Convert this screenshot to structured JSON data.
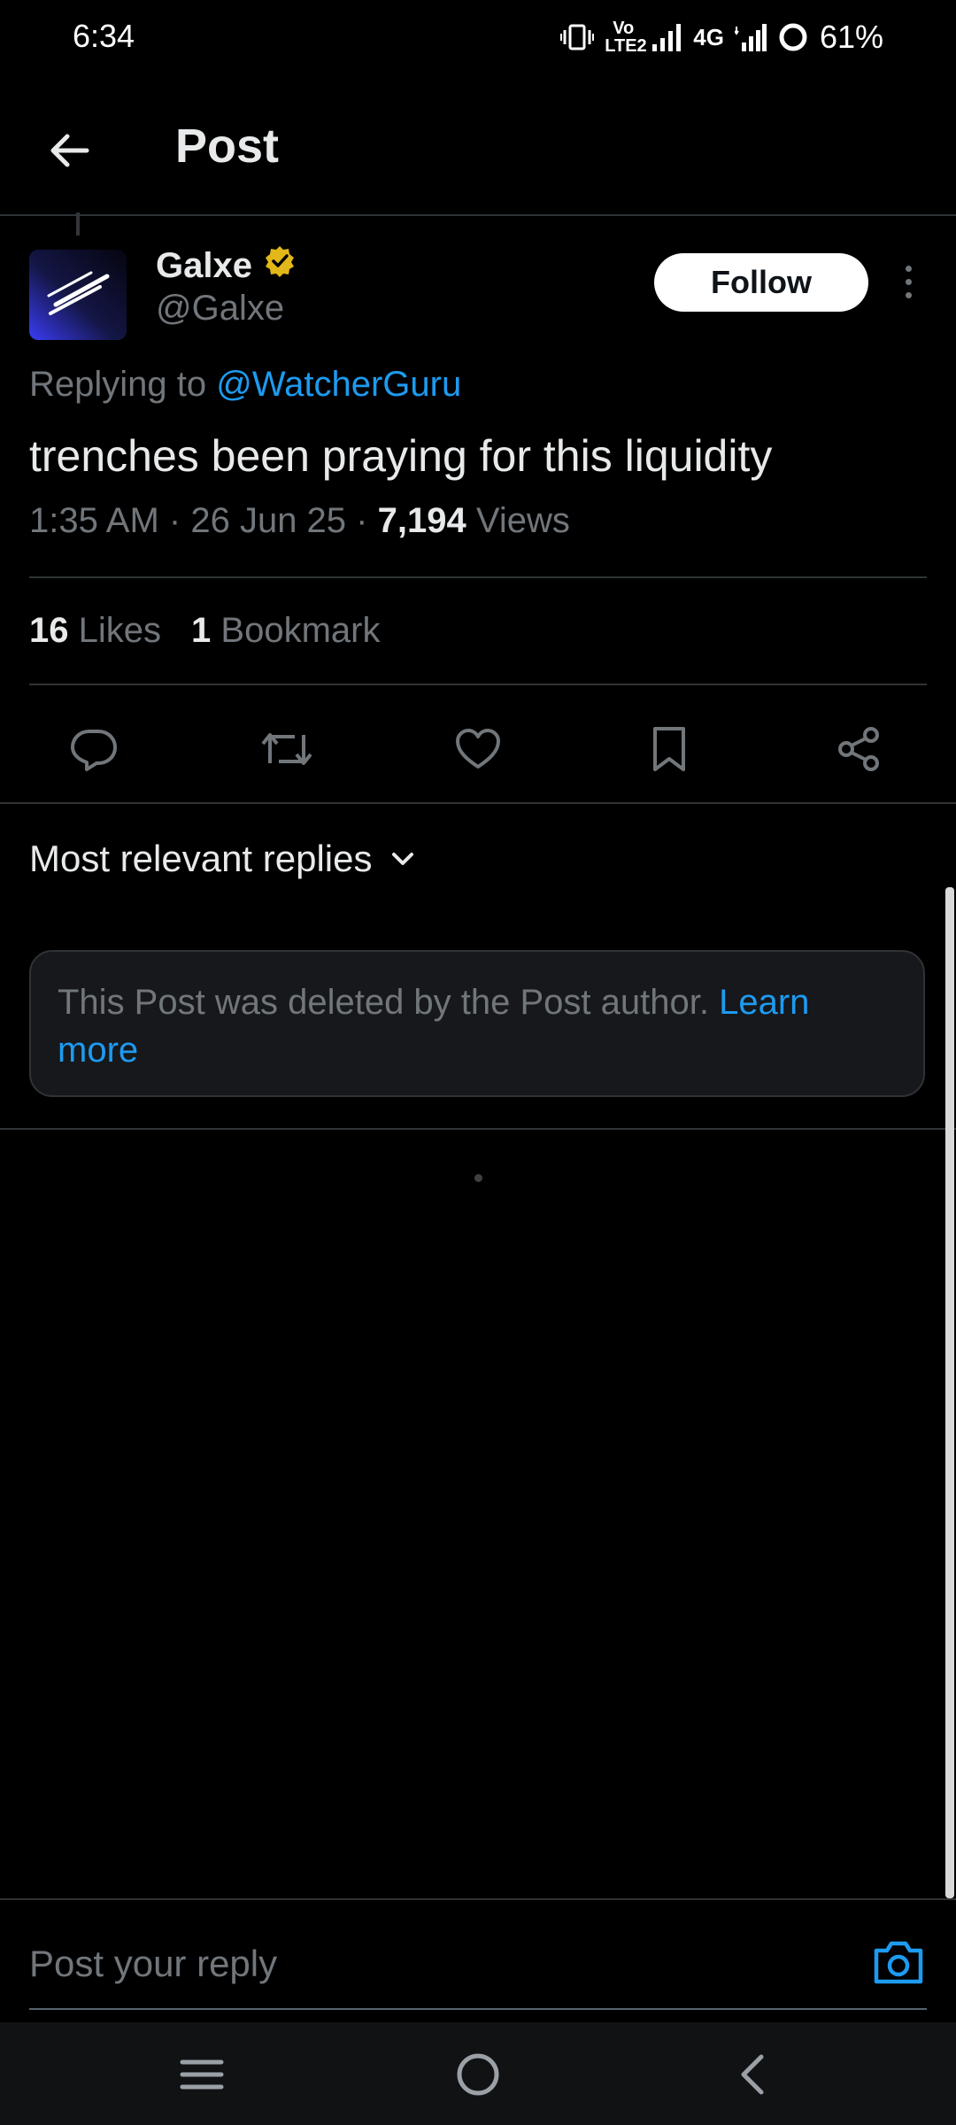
{
  "status_bar": {
    "time": "6:34",
    "volte_label": "Vo LTE2",
    "network": "4G",
    "battery": "61%"
  },
  "header": {
    "title": "Post"
  },
  "post": {
    "author_name": "Galxe",
    "author_handle": "@Galxe",
    "verified_badge_color": "#e2b719",
    "follow_label": "Follow",
    "replying_prefix": "Replying to",
    "replying_to": "@WatcherGuru",
    "text": "trenches been praying for this liquidity",
    "time": "1:35 AM",
    "date": "26 Jun 25",
    "views_count": "7,194",
    "views_label": "Views",
    "likes_count": "16",
    "likes_label": "Likes",
    "bookmarks_count": "1",
    "bookmarks_label": "Bookmark"
  },
  "actions": [
    "reply-icon",
    "repost-icon",
    "like-icon",
    "bookmark-icon",
    "share-icon"
  ],
  "replies": {
    "sort_label": "Most relevant replies",
    "deleted_notice": "This Post was deleted by the Post author.",
    "learn_more": "Learn more"
  },
  "composer": {
    "placeholder": "Post your reply"
  },
  "colors": {
    "accent": "#1d9bf0",
    "background": "#000000",
    "text_primary": "#e7e9ea",
    "text_secondary": "#71767b",
    "border": "#2f3336"
  }
}
